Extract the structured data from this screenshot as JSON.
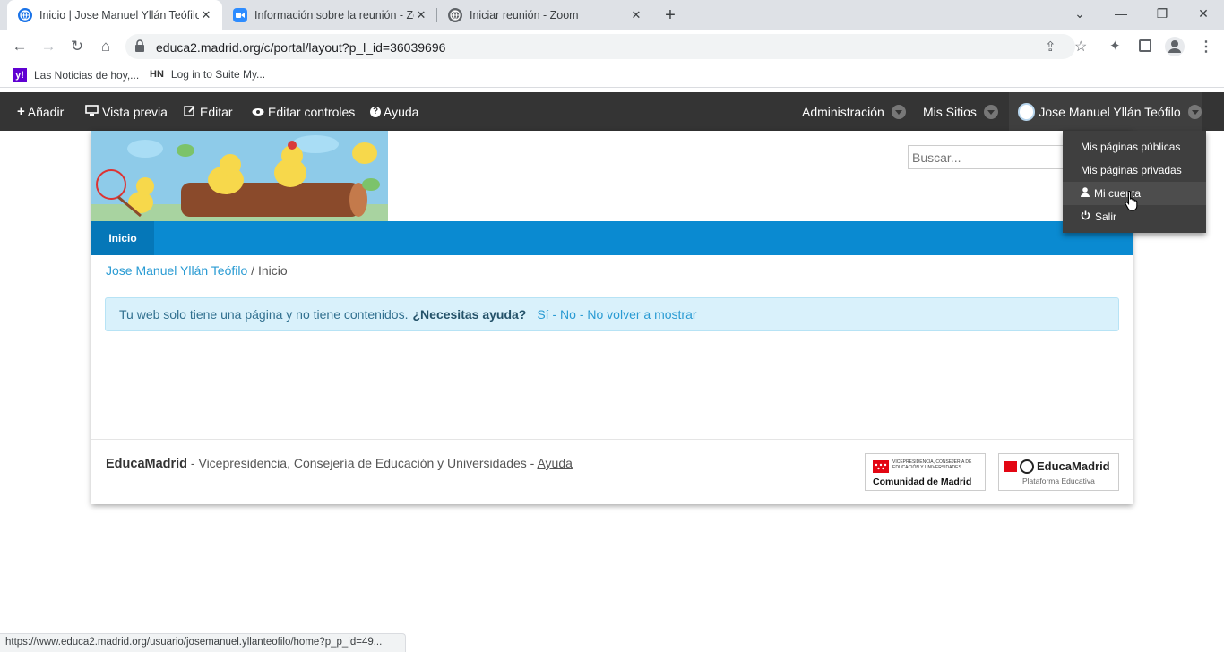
{
  "browser": {
    "tabs": [
      {
        "title": "Inicio | Jose Manuel Yllán Teófilo"
      },
      {
        "title": "Información sobre la reunión - Zoom"
      },
      {
        "title": "Iniciar reunión - Zoom"
      }
    ],
    "url": "educa2.madrid.org/c/portal/layout?p_l_id=36039696",
    "bookmarks": [
      {
        "label": "Las Noticias de hoy,..."
      },
      {
        "label": "Log in to Suite My..."
      }
    ],
    "status_url": "https://www.educa2.madrid.org/usuario/josemanuel.yllanteofilo/home?p_p_id=49..."
  },
  "dockbar": {
    "add": "Añadir",
    "preview": "Vista previa",
    "edit": "Editar",
    "edit_controls": "Editar controles",
    "help": "Ayuda",
    "admin": "Administración",
    "my_sites": "Mis Sitios",
    "user": "Jose Manuel Yllán Teófilo"
  },
  "user_menu": {
    "items": [
      {
        "label": "Mis páginas públicas"
      },
      {
        "label": "Mis páginas privadas"
      },
      {
        "label": "Mi cuenta"
      },
      {
        "label": "Salir"
      }
    ]
  },
  "page": {
    "search_placeholder": "Buscar...",
    "nav_home": "Inicio",
    "breadcrumb": {
      "owner": "Jose Manuel Yllán Teófilo",
      "sep": "/",
      "current": "Inicio"
    },
    "alert": {
      "text": "Tu web solo tiene una página y no tiene contenidos.",
      "question": "¿Necesitas ayuda?",
      "yes": "Sí",
      "no": "No",
      "dont_show": "No volver a mostrar"
    },
    "footer": {
      "brand": "EducaMadrid",
      "text": " - Vicepresidencia, Consejería de Educación y Universidades - ",
      "help": "Ayuda",
      "logo1_small": "VICEPRESIDENCIA, CONSEJERÍA DE EDUCACIÓN Y UNIVERSIDADES",
      "logo1_main": "Comunidad de Madrid",
      "logo2_main": "EducaMadrid",
      "logo2_sub": "Plataforma Educativa"
    }
  }
}
